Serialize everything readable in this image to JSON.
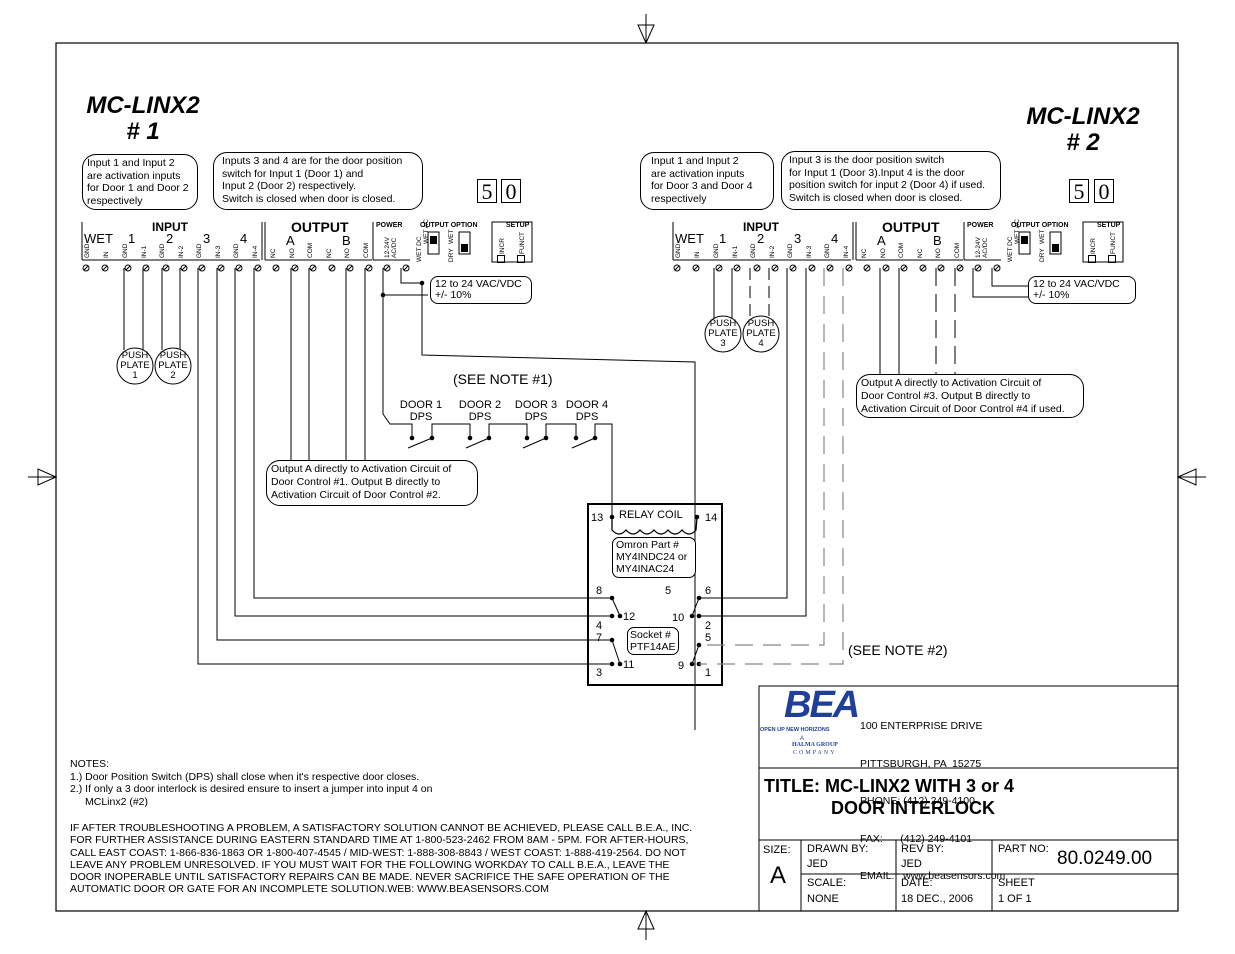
{
  "titles": {
    "unit1": {
      "name": "MC-LINX2",
      "number": "# 1"
    },
    "unit2": {
      "name": "MC-LINX2",
      "number": "# 2"
    }
  },
  "dip_display": [
    "5",
    "0"
  ],
  "unit1_notes": {
    "activation": [
      "Input 1 and Input 2",
      "are activation inputs",
      "for Door 1 and Door 2",
      "respectively"
    ],
    "door_position": [
      "Inputs 3 and 4 are for the door position",
      "switch for Input 1 (Door 1) and",
      "Input 2 (Door 2) respectively.",
      "Switch is closed when door is closed."
    ]
  },
  "unit2_notes": {
    "activation": [
      "Input 1 and Input 2",
      "are activation inputs",
      "for Door 3 and Door 4",
      "respectively"
    ],
    "door_position": [
      "Input 3 is the door position switch",
      "for Input 1 (Door 3).Input 4 is the door",
      "position switch for input 2 (Door 4) if used.",
      "Switch is closed when door is closed."
    ]
  },
  "terminal_block": {
    "input_header": "INPUT",
    "output_header": "OUTPUT",
    "power_header": "POWER",
    "output_option_header": "OUTPUT OPTION",
    "setup_header": "SETUP",
    "input_groups": [
      "WET",
      "1",
      "2",
      "3",
      "4"
    ],
    "output_groups": [
      "A",
      "B"
    ],
    "input_pins": [
      "GND",
      "IN",
      "GND",
      "IN-1",
      "GND",
      "IN-2",
      "GND",
      "IN-3",
      "GND",
      "IN-4"
    ],
    "output_pins": [
      "NC",
      "NO",
      "COM",
      "NC",
      "NO",
      "COM"
    ],
    "power_pins": "12-24V AC/DC",
    "output_option_labels": [
      "WET DC",
      "WET AC",
      "DRY",
      "WET"
    ],
    "setup_labels": [
      "INCR",
      "FUNCT"
    ]
  },
  "power_note": [
    "12 to 24 VAC/VDC",
    "+/- 10%"
  ],
  "push_plates": [
    {
      "label": [
        "PUSH",
        "PLATE",
        "1"
      ]
    },
    {
      "label": [
        "PUSH",
        "PLATE",
        "2"
      ]
    },
    {
      "label": [
        "PUSH",
        "PLATE",
        "3"
      ]
    },
    {
      "label": [
        "PUSH",
        "PLATE",
        "4"
      ]
    }
  ],
  "see_note_1": "(SEE NOTE #1)",
  "see_note_2": "(SEE NOTE #2)",
  "dps_switches": [
    {
      "line1": "DOOR 1",
      "line2": "DPS"
    },
    {
      "line1": "DOOR 2",
      "line2": "DPS"
    },
    {
      "line1": "DOOR 3",
      "line2": "DPS"
    },
    {
      "line1": "DOOR 4",
      "line2": "DPS"
    }
  ],
  "output_note_1": [
    "Output A directly to Activation Circuit of",
    "Door Control #1. Output B directly to",
    "Activation Circuit of Door Control #2."
  ],
  "output_note_2": [
    "Output A directly to Activation Circuit of",
    "Door Control #3. Output B directly to",
    "Activation Circuit of Door Control #4 if used."
  ],
  "relay": {
    "coil_label": "RELAY COIL",
    "coil_pins": [
      "13",
      "14"
    ],
    "part_note": [
      "Omron Part #",
      "MY4INDC24 or",
      "MY4INAC24"
    ],
    "socket_note": [
      "Socket #",
      "PTF14AE"
    ],
    "pins": {
      "p8": "8",
      "p5": "5",
      "p6": "6",
      "p12": "12",
      "p10": "10",
      "p4": "4",
      "p2": "2",
      "p7": "7",
      "p5b": "5",
      "p11": "11",
      "p9": "9",
      "p3": "3",
      "p1": "1"
    }
  },
  "notes": {
    "heading": "NOTES:",
    "items": [
      "1.) Door Position Switch (DPS) shall close when it's respective door closes.",
      "2.) If only a 3 door interlock is desired ensure to insert a jumper into input 4 on",
      "MCLinx2 (#2)"
    ]
  },
  "disclaimer": [
    "IF AFTER TROUBLESHOOTING A PROBLEM, A SATISFACTORY SOLUTION CANNOT BE ACHIEVED, PLEASE CALL B.E.A., INC.",
    "FOR FURTHER ASSISTANCE DURING EASTERN STANDARD TIME AT 1-800-523-2462 FROM 8AM - 5PM. FOR AFTER-HOURS,",
    "CALL EAST COAST: 1-866-836-1863 OR 1-800-407-4545 / MID-WEST: 1-888-308-8843 / WEST COAST: 1-888-419-2564. DO NOT",
    "LEAVE ANY PROBLEM UNRESOLVED. IF YOU MUST WAIT FOR THE FOLLOWING WORKDAY TO CALL B.E.A., LEAVE THE",
    "DOOR INOPERABLE UNTIL SATISFACTORY REPAIRS CAN BE MADE. NEVER SACRIFICE THE SAFE OPERATION OF THE",
    "AUTOMATIC DOOR OR GATE FOR AN INCOMPLETE SOLUTION.WEB: WWW.BEASENSORS.COM"
  ],
  "title_block": {
    "logo": {
      "brand": "BEA",
      "tagline": "OPEN UP NEW HORIZONS",
      "group_a": "A",
      "group_1": "HALMA GROUP",
      "group_2": "COMPANY",
      "brand_color": "#1f3f9b"
    },
    "address": [
      "100 ENTERPRISE DRIVE",
      "PITTSBURGH, PA  15275",
      "PHONE: (412) 249-4100",
      "FAX:      (412) 249-4101",
      "EMAIL:   www.beasensors.com"
    ],
    "title_line1": "TITLE: MC-LINX2 WITH 3 or 4",
    "title_line2": "DOOR INTERLOCK",
    "size_label": "SIZE:",
    "size_value": "A",
    "drawn_by_label": "DRAWN BY:",
    "drawn_by_value": "JED",
    "rev_by_label": "REV BY:",
    "rev_by_value": "JED",
    "part_no_label": "PART NO:",
    "part_no_value": "80.0249.00",
    "scale_label": "SCALE:",
    "scale_value": "NONE",
    "date_label": "DATE:",
    "date_value": "18 DEC., 2006",
    "sheet_label": "SHEET",
    "sheet_value": "1 OF 1"
  }
}
